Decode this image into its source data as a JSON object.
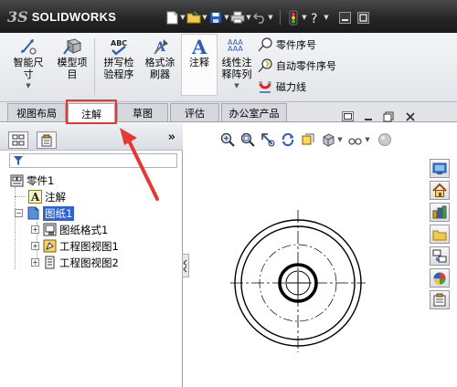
{
  "app": {
    "logo_mark": "3S",
    "logo_text": "SOLIDWORKS"
  },
  "quick_access": {
    "icons": [
      "new-document-icon",
      "open-folder-icon",
      "save-icon",
      "print-icon",
      "undo-icon",
      "rebuild-traffic-light-icon",
      "help-icon",
      "minimize-icon",
      "restore-icon"
    ]
  },
  "ribbon": {
    "buttons": [
      {
        "label": "智能尺\n寸",
        "icon": "smart-dimension-icon"
      },
      {
        "label": "模型项\n目",
        "icon": "model-items-icon"
      },
      {
        "label": "拼写检\n验程序",
        "icon": "spell-checker-icon"
      },
      {
        "label": "格式涂\n刷器",
        "icon": "format-painter-icon"
      },
      {
        "label": "注释",
        "icon": "note-icon"
      },
      {
        "label": "线性注\n释阵列",
        "icon": "linear-note-pattern-icon"
      }
    ],
    "small_items": [
      {
        "label": "零件序号",
        "icon": "balloon-icon"
      },
      {
        "label": "自动零件序号",
        "icon": "auto-balloon-icon"
      },
      {
        "label": "磁力线",
        "icon": "magnetic-line-icon"
      }
    ]
  },
  "tabs": [
    {
      "label": "视图布局"
    },
    {
      "label": "注解"
    },
    {
      "label": "草图"
    },
    {
      "label": "评估"
    },
    {
      "label": "办公室产品"
    }
  ],
  "active_tab": "注解",
  "feature_tree": {
    "more": "»",
    "items": [
      {
        "label": "零件1",
        "icon": "drawing-document-icon"
      },
      {
        "label": "注解",
        "icon": "annotations-icon"
      },
      {
        "label": "图纸1",
        "icon": "sheet-icon"
      },
      {
        "label": "图纸格式1",
        "icon": "sheet-format-icon"
      },
      {
        "label": "工程图视图1",
        "icon": "drawing-view-icon"
      },
      {
        "label": "工程图视图2",
        "icon": "drawing-view-icon"
      }
    ],
    "selected": "图纸1"
  },
  "colors": {
    "highlight_red": "#e53935",
    "selection_blue": "#2f63d2"
  }
}
